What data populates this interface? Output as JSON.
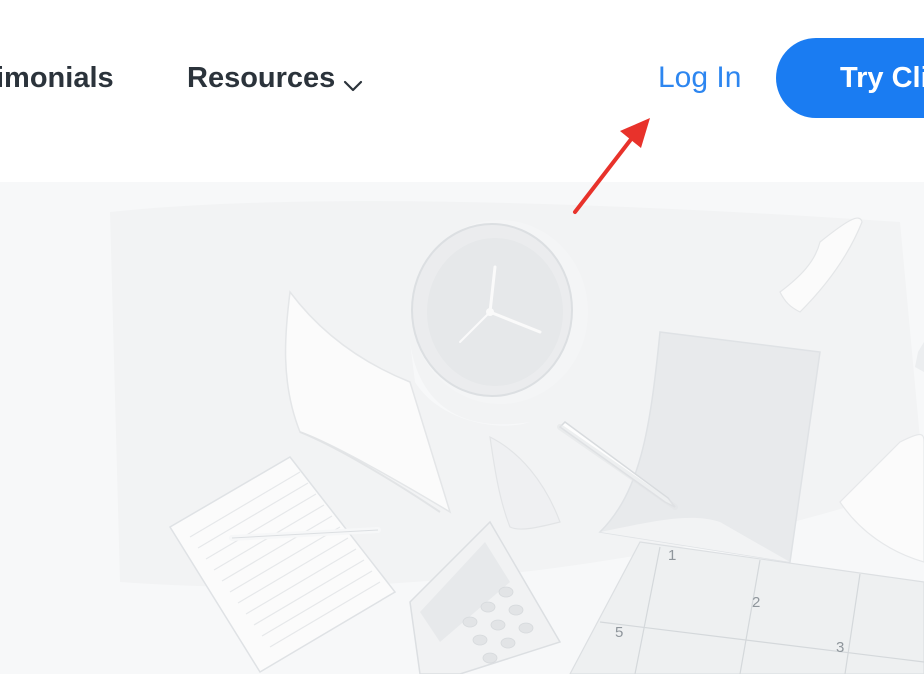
{
  "header": {
    "nav": [
      {
        "label": "imonials"
      },
      {
        "label": "Resources"
      }
    ],
    "login_label": "Log In",
    "cta_label": "Try Cli"
  },
  "icons": {
    "resources_dropdown": "chevron-down-icon",
    "annotation": "red-arrow-icon"
  },
  "hero": {
    "illustration": "floating-office-items",
    "calendar_numbers": [
      "1",
      "2",
      "5",
      "3"
    ]
  },
  "colors": {
    "login_link": "#2d86f0",
    "cta_background": "#1a7cf2",
    "nav_text": "#2b333b",
    "annotation_arrow": "#e8322b",
    "hero_background": "#f7f8f9"
  }
}
